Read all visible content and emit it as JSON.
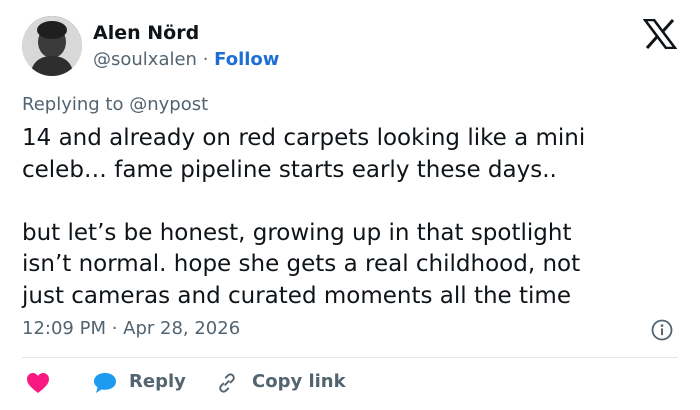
{
  "author": {
    "display_name": "Alen Nörd",
    "handle": "@soulxalen",
    "separator": " · ",
    "follow_label": "Follow"
  },
  "reply_context": {
    "prefix": "Replying to ",
    "mention": "@nypost"
  },
  "tweet": {
    "text": "14 and already on red carpets looking like a mini\nceleb… fame pipeline starts early these days..\n\nbut let’s be honest, growing up in that spotlight\nisn’t normal. hope she gets a real childhood, not\njust cameras and curated moments all the time",
    "timestamp": "12:09 PM · Apr 28, 2026"
  },
  "actions": {
    "reply_label": "Reply",
    "copy_link_label": "Copy link"
  },
  "colors": {
    "heart": "#f91880",
    "reply_bubble": "#1d9bf0",
    "follow": "#1d6fd6",
    "secondary_text": "#536471"
  },
  "icons": [
    "x-logo-icon",
    "info-icon",
    "heart-icon",
    "reply-bubble-icon",
    "link-icon"
  ]
}
